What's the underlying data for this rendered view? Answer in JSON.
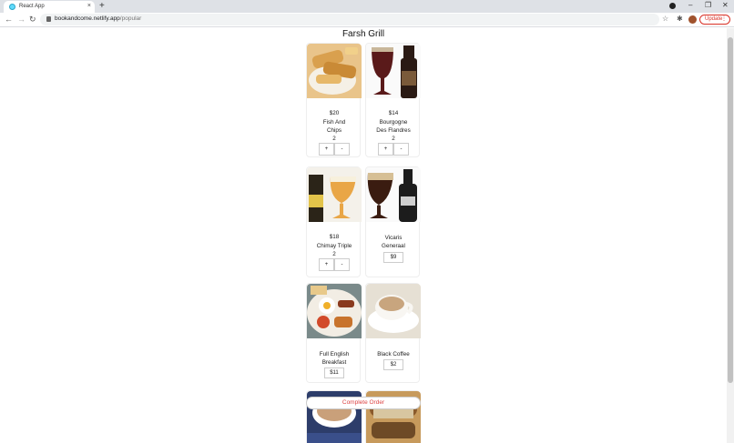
{
  "browser": {
    "tab_title": "React App",
    "new_tab": "+",
    "tab_close": "×",
    "url_host": "bookandcome.netlify.app",
    "url_path": "/popular",
    "update_label": "Update",
    "update_menu": "⋮",
    "window_minimize": "–",
    "window_restore": "❐",
    "window_close": "✕",
    "back": "←",
    "forward": "→",
    "reload": "↻",
    "star": "☆",
    "extensions": "✱"
  },
  "page": {
    "title": "Farsh Grill",
    "complete_order": "Complete Order"
  },
  "items": [
    {
      "name_1": "Fish And",
      "name_2": "Chips",
      "price": "$20",
      "qty": "2",
      "plus": "+",
      "minus": "-"
    },
    {
      "name_1": "Bourgogne",
      "name_2": "Des Flandres",
      "price": "$14",
      "qty": "2",
      "plus": "+",
      "minus": "-"
    },
    {
      "name_1": "Chimay Triple",
      "price": "$18",
      "qty": "2",
      "plus": "+",
      "minus": "-"
    },
    {
      "name_1": "Vicaris",
      "name_2": "Generaal",
      "price": "$9"
    },
    {
      "name_1": "Full English",
      "name_2": "Breakfast",
      "price": "$11"
    },
    {
      "name_1": "Black Coffee",
      "price": "$2"
    }
  ]
}
